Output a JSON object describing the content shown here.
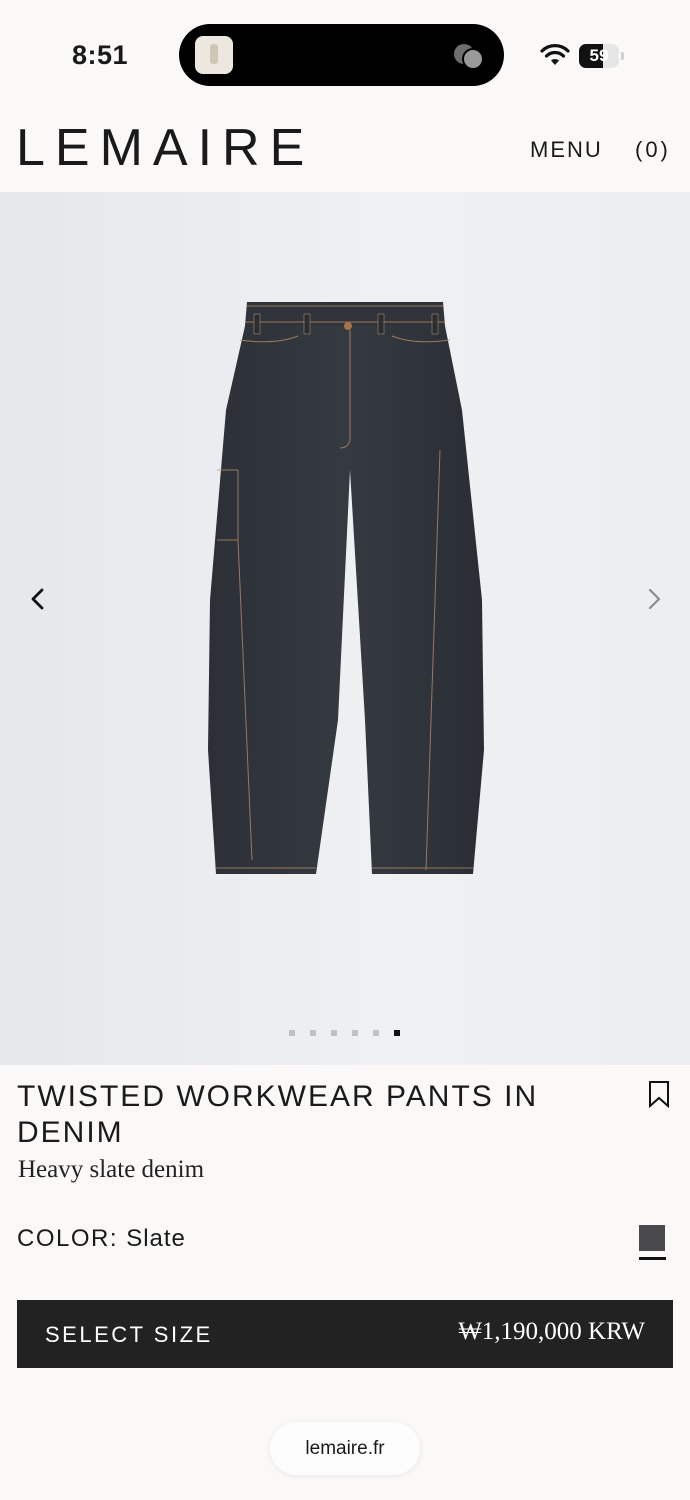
{
  "status_bar": {
    "time": "8:51",
    "battery_level": "59",
    "battery_fraction": 0.59
  },
  "header": {
    "brand": "LEMAIRE",
    "menu_label": "MENU",
    "cart_label": "(0)"
  },
  "gallery": {
    "image_count": 6,
    "active_index": 5,
    "product_image_icon": "denim-pants-photo"
  },
  "product": {
    "title": "TWISTED WORKWEAR PANTS IN DENIM",
    "subtitle": "Heavy slate denim",
    "color_label": "COLOR:",
    "color_value": "Slate",
    "swatch_color": "#4a4a4d",
    "select_size_label": "SELECT SIZE",
    "price": "₩1,190,000 KRW"
  },
  "browser": {
    "url": "lemaire.fr"
  }
}
